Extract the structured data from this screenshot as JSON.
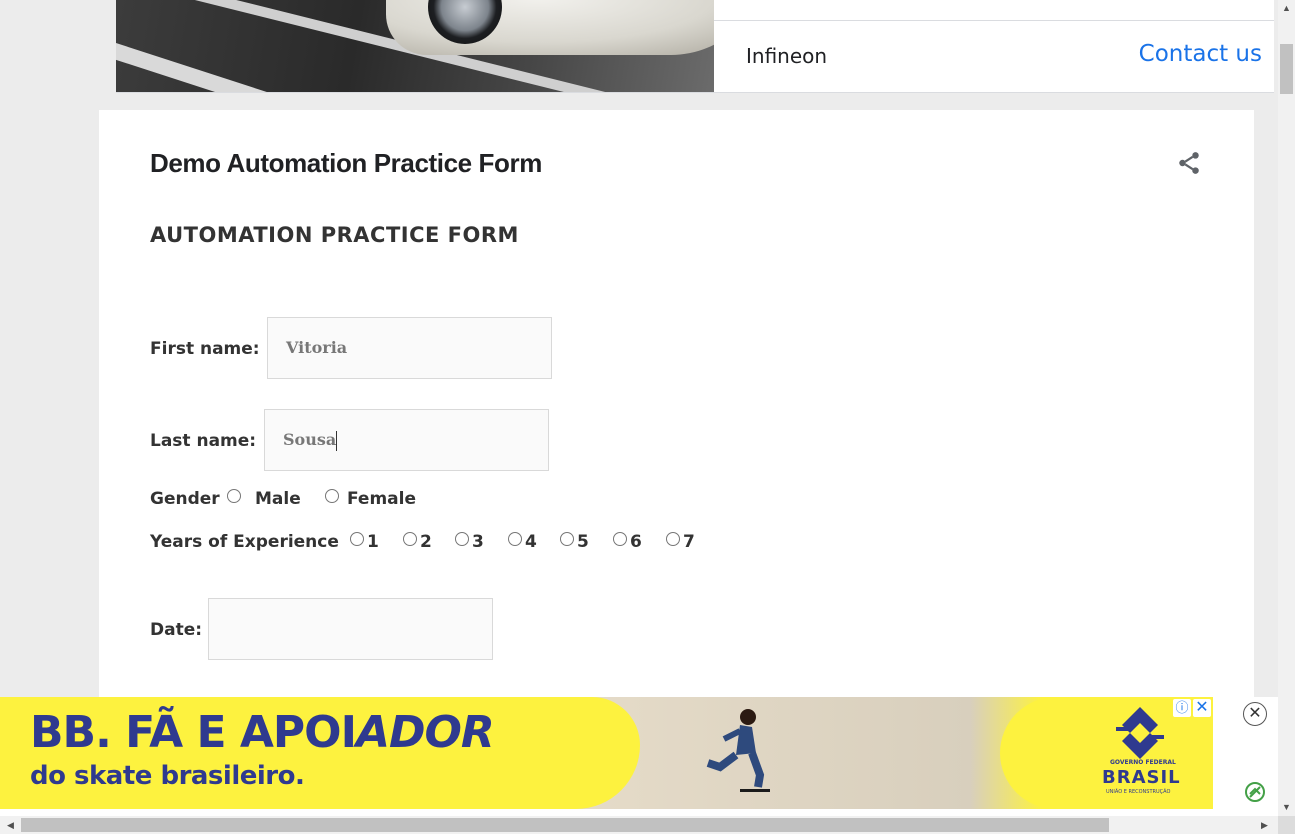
{
  "top_ad": {
    "brand": "Infineon",
    "cta": "Contact us"
  },
  "post": {
    "title": "Demo Automation Practice Form",
    "share_icon": "share-icon"
  },
  "form": {
    "heading": "AUTOMATION PRACTICE FORM",
    "first_name": {
      "label": "First name:",
      "value": "Vitoria"
    },
    "last_name": {
      "label": "Last name:",
      "value": "Sousa"
    },
    "gender": {
      "label": "Gender",
      "options": [
        "Male",
        "Female"
      ]
    },
    "experience": {
      "label": "Years of Experience",
      "options": [
        "1",
        "2",
        "3",
        "4",
        "5",
        "6",
        "7"
      ]
    },
    "date": {
      "label": "Date:",
      "value": ""
    }
  },
  "bottom_ad": {
    "line1_part1": "BB. FÃ E APOI",
    "line1_part2": "ADOR",
    "line2": "do skate brasileiro.",
    "gov_small": "GOVERNO FEDERAL",
    "gov_brasil": "BRASIL",
    "gov_sub": "UNIÃO E RECONSTRUÇÃO",
    "info_glyph": "ⓘ",
    "close_glyph": "✕",
    "dismiss_glyph": "✕",
    "colors": {
      "yellow": "#fdf23f",
      "blue": "#2f3a8f"
    }
  },
  "theme": {
    "link_blue": "#1a73e8",
    "text_dark": "#202124",
    "page_bg": "#ececec"
  }
}
